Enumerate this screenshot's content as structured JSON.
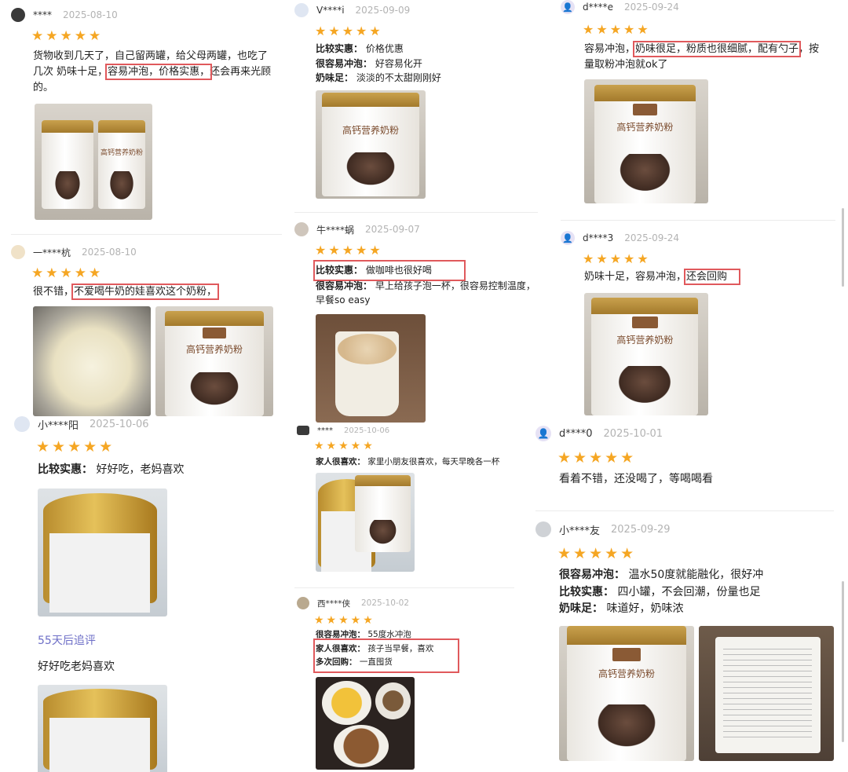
{
  "reviews": [
    {
      "user": "****",
      "date": "2025-08-10",
      "stars": "★★★★★",
      "lines": [
        "货物收到几天了，自己留两罐，给父母两罐，也吃了",
        "几次 奶味十足，",
        "容易冲泡，价格实惠，",
        "还会再来光顾",
        "的。"
      ]
    },
    {
      "user": "一****杭",
      "date": "2025-08-10",
      "stars": "★★★★★",
      "pre": "很不错，",
      "hl": "不爱喝牛奶的娃喜欢这个奶粉，"
    },
    {
      "user": "小****阳",
      "date": "2025-10-06",
      "stars": "★★★★★",
      "k1": "比较实惠：",
      "v1": "好好吃，老妈喜欢",
      "followup": "55天后追评",
      "follow_text": "好好吃老妈喜欢"
    },
    {
      "user": "V****i",
      "date": "2025-09-09",
      "stars": "★★★★★",
      "k1": "比较实惠：",
      "v1": "价格优惠",
      "k2": "很容易冲泡：",
      "v2": "好容易化开",
      "k3": "奶味足：",
      "v3": "淡淡的不太甜刚刚好"
    },
    {
      "user": "牛****蜗",
      "date": "2025-09-07",
      "stars": "★★★★★",
      "k1": "比较实惠：",
      "v1": "做咖啡也很好喝",
      "k2": "很容易冲泡：",
      "v2": "早上给孩子泡一杯，很容易控制温度，",
      "v2b": "早餐so easy"
    },
    {
      "user": "****",
      "date": "2025-10-06",
      "stars": "★★★★★",
      "k1": "家人很喜欢：",
      "v1": "家里小朋友很喜欢，每天早晚各一杯"
    },
    {
      "user": "西****侠",
      "date": "2025-10-02",
      "stars": "★★★★★",
      "k1": "很容易冲泡：",
      "v1": "55度水冲泡",
      "k2": "家人很喜欢：",
      "v2": "孩子当早餐，喜欢",
      "k3": "多次回购：",
      "v3": "一直囤货"
    },
    {
      "user": "d****e",
      "date": "2025-09-24",
      "stars": "★★★★★",
      "pre": "容易冲泡，",
      "hl": "奶味很足，粉质也很细腻，配有勺子",
      "post": "，按",
      "line2": "量取粉冲泡就ok了"
    },
    {
      "user": "d****3",
      "date": "2025-09-24",
      "stars": "★★★★★",
      "pre": "奶味十足，容易冲泡，",
      "hl": "还会回购"
    },
    {
      "user": "d****0",
      "date": "2025-10-01",
      "stars": "★★★★★",
      "text": "看着不错，还没喝了，等喝喝看"
    },
    {
      "user": "小****友",
      "date": "2025-09-29",
      "stars": "★★★★★",
      "k1": "很容易冲泡：",
      "v1": "温水50度就能融化，很好冲",
      "k2": "比较实惠：",
      "v2": "四小罐，不会回潮，份量也足",
      "k3": "奶味足：",
      "v3": "味道好，奶味浓"
    }
  ],
  "product": {
    "can_title": "高钙营养奶粉"
  }
}
